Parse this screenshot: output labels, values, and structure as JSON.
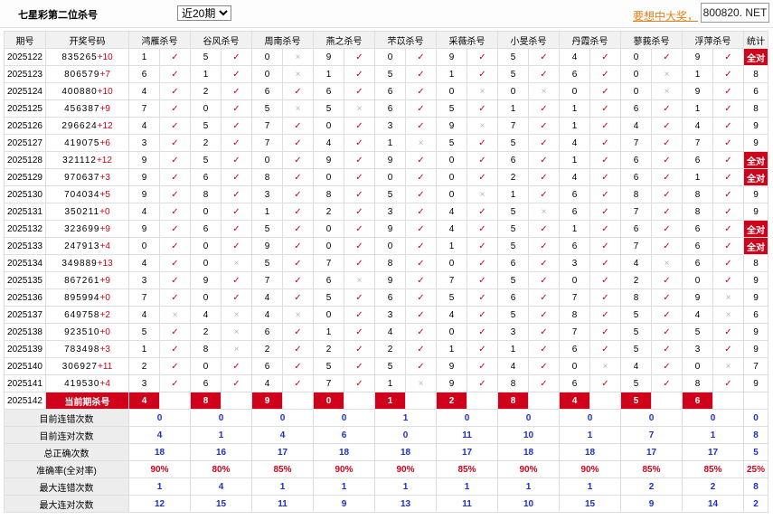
{
  "header": {
    "title": "七星彩第二位杀号",
    "select_value": "近20期",
    "select_options": [
      "近20期"
    ],
    "promo_text": "要想中大奖，",
    "site_badge": "800820. NET"
  },
  "columns": {
    "issue": "期号",
    "draw": "开奖号码",
    "experts": [
      "鸿雁杀号",
      "谷风杀号",
      "周南杀号",
      "燕之杀号",
      "芣苡杀号",
      "采薇杀号",
      "小旻杀号",
      "丹霞杀号",
      "蓼莪杀号",
      "浮萍杀号"
    ],
    "stat": "统计"
  },
  "marks": {
    "correct": "✓",
    "wrong": "×"
  },
  "rows": [
    {
      "issue": "2025122",
      "digits": "835265",
      "sum": "+10",
      "kills": [
        "1",
        "5",
        "0",
        "9",
        "0",
        "9",
        "5",
        "4",
        "0",
        "9"
      ],
      "ok": [
        1,
        1,
        0,
        1,
        1,
        1,
        1,
        1,
        1,
        1
      ],
      "stat": "全对"
    },
    {
      "issue": "2025123",
      "digits": "806579",
      "sum": "+7",
      "kills": [
        "6",
        "1",
        "0",
        "1",
        "5",
        "1",
        "5",
        "6",
        "0",
        "1"
      ],
      "ok": [
        1,
        1,
        0,
        1,
        1,
        1,
        1,
        1,
        0,
        1
      ],
      "stat": "8"
    },
    {
      "issue": "2025124",
      "digits": "400880",
      "sum": "+10",
      "kills": [
        "4",
        "2",
        "6",
        "6",
        "6",
        "0",
        "0",
        "0",
        "0",
        "9"
      ],
      "ok": [
        1,
        1,
        1,
        1,
        1,
        0,
        0,
        1,
        0,
        1
      ],
      "stat": "6"
    },
    {
      "issue": "2025125",
      "digits": "456387",
      "sum": "+9",
      "kills": [
        "7",
        "0",
        "5",
        "5",
        "6",
        "5",
        "1",
        "1",
        "6",
        "1"
      ],
      "ok": [
        1,
        1,
        0,
        0,
        1,
        1,
        1,
        1,
        1,
        1
      ],
      "stat": "8"
    },
    {
      "issue": "2025126",
      "digits": "296624",
      "sum": "+12",
      "kills": [
        "4",
        "5",
        "7",
        "0",
        "3",
        "9",
        "7",
        "1",
        "4",
        "4"
      ],
      "ok": [
        1,
        1,
        1,
        1,
        1,
        0,
        1,
        1,
        1,
        1
      ],
      "stat": "9"
    },
    {
      "issue": "2025127",
      "digits": "419075",
      "sum": "+6",
      "kills": [
        "3",
        "2",
        "7",
        "4",
        "1",
        "5",
        "5",
        "4",
        "7",
        "7"
      ],
      "ok": [
        1,
        1,
        1,
        1,
        0,
        1,
        1,
        1,
        1,
        1
      ],
      "stat": "9"
    },
    {
      "issue": "2025128",
      "digits": "321112",
      "sum": "+12",
      "kills": [
        "9",
        "5",
        "0",
        "9",
        "9",
        "0",
        "6",
        "1",
        "6",
        "6"
      ],
      "ok": [
        1,
        1,
        1,
        1,
        1,
        1,
        1,
        1,
        1,
        1
      ],
      "stat": "全对"
    },
    {
      "issue": "2025129",
      "digits": "970637",
      "sum": "+3",
      "kills": [
        "9",
        "6",
        "8",
        "0",
        "0",
        "0",
        "2",
        "4",
        "6",
        "1"
      ],
      "ok": [
        1,
        1,
        1,
        1,
        1,
        1,
        1,
        1,
        1,
        1
      ],
      "stat": "全对"
    },
    {
      "issue": "2025130",
      "digits": "704034",
      "sum": "+5",
      "kills": [
        "9",
        "8",
        "3",
        "8",
        "5",
        "0",
        "1",
        "6",
        "8",
        "8"
      ],
      "ok": [
        1,
        1,
        1,
        1,
        1,
        0,
        1,
        1,
        1,
        1
      ],
      "stat": "9"
    },
    {
      "issue": "2025131",
      "digits": "350211",
      "sum": "+0",
      "kills": [
        "4",
        "0",
        "1",
        "2",
        "3",
        "4",
        "5",
        "6",
        "7",
        "8"
      ],
      "ok": [
        1,
        1,
        1,
        1,
        1,
        1,
        0,
        1,
        1,
        1
      ],
      "stat": "9"
    },
    {
      "issue": "2025132",
      "digits": "323699",
      "sum": "+9",
      "kills": [
        "9",
        "6",
        "5",
        "0",
        "9",
        "4",
        "5",
        "1",
        "6",
        "6"
      ],
      "ok": [
        1,
        1,
        1,
        1,
        1,
        1,
        1,
        1,
        1,
        1
      ],
      "stat": "全对"
    },
    {
      "issue": "2025133",
      "digits": "247913",
      "sum": "+4",
      "kills": [
        "0",
        "0",
        "9",
        "0",
        "0",
        "1",
        "5",
        "6",
        "7",
        "6"
      ],
      "ok": [
        1,
        1,
        1,
        1,
        1,
        1,
        1,
        1,
        1,
        1
      ],
      "stat": "全对"
    },
    {
      "issue": "2025134",
      "digits": "349889",
      "sum": "+13",
      "kills": [
        "4",
        "0",
        "5",
        "7",
        "8",
        "0",
        "6",
        "3",
        "4",
        "6"
      ],
      "ok": [
        1,
        0,
        1,
        1,
        1,
        1,
        1,
        1,
        0,
        1
      ],
      "stat": "8"
    },
    {
      "issue": "2025135",
      "digits": "867261",
      "sum": "+9",
      "kills": [
        "3",
        "9",
        "7",
        "6",
        "9",
        "7",
        "5",
        "0",
        "2",
        "0"
      ],
      "ok": [
        1,
        1,
        1,
        0,
        1,
        1,
        1,
        1,
        1,
        1
      ],
      "stat": "9"
    },
    {
      "issue": "2025136",
      "digits": "895994",
      "sum": "+0",
      "kills": [
        "7",
        "0",
        "4",
        "5",
        "6",
        "5",
        "6",
        "7",
        "8",
        "9"
      ],
      "ok": [
        1,
        1,
        1,
        1,
        1,
        1,
        1,
        1,
        1,
        0
      ],
      "stat": "9"
    },
    {
      "issue": "2025137",
      "digits": "649758",
      "sum": "+2",
      "kills": [
        "4",
        "4",
        "4",
        "0",
        "3",
        "4",
        "5",
        "8",
        "5",
        "4"
      ],
      "ok": [
        0,
        0,
        0,
        1,
        1,
        1,
        1,
        1,
        1,
        0
      ],
      "stat": "6"
    },
    {
      "issue": "2025138",
      "digits": "923510",
      "sum": "+0",
      "kills": [
        "5",
        "2",
        "6",
        "1",
        "4",
        "0",
        "3",
        "7",
        "5",
        "5"
      ],
      "ok": [
        1,
        0,
        1,
        1,
        1,
        1,
        1,
        1,
        1,
        1
      ],
      "stat": "9"
    },
    {
      "issue": "2025139",
      "digits": "783498",
      "sum": "+3",
      "kills": [
        "1",
        "8",
        "2",
        "2",
        "2",
        "1",
        "1",
        "6",
        "5",
        "3"
      ],
      "ok": [
        1,
        0,
        1,
        1,
        1,
        1,
        1,
        1,
        1,
        1
      ],
      "stat": "9"
    },
    {
      "issue": "2025140",
      "digits": "306927",
      "sum": "+11",
      "kills": [
        "2",
        "0",
        "6",
        "5",
        "5",
        "9",
        "4",
        "0",
        "4",
        "0"
      ],
      "ok": [
        1,
        1,
        1,
        1,
        1,
        1,
        1,
        0,
        1,
        0
      ],
      "stat": "7"
    },
    {
      "issue": "2025141",
      "digits": "419530",
      "sum": "+4",
      "kills": [
        "3",
        "6",
        "4",
        "7",
        "1",
        "9",
        "8",
        "6",
        "5",
        "8"
      ],
      "ok": [
        1,
        1,
        1,
        1,
        0,
        1,
        1,
        1,
        1,
        1
      ],
      "stat": "9"
    }
  ],
  "current": {
    "issue": "2025142",
    "label": "当前期杀号",
    "kills": [
      "4",
      "8",
      "9",
      "0",
      "1",
      "2",
      "8",
      "4",
      "5",
      "6"
    ]
  },
  "summary": [
    {
      "label": "目前连错次数",
      "values": [
        "0",
        "0",
        "0",
        "0",
        "1",
        "0",
        "0",
        "0",
        "0",
        "0",
        "0"
      ],
      "color": "blue"
    },
    {
      "label": "目前连对次数",
      "values": [
        "4",
        "1",
        "4",
        "6",
        "0",
        "11",
        "10",
        "1",
        "7",
        "1",
        "8"
      ],
      "color": "blue"
    },
    {
      "label": "总正确次数",
      "values": [
        "18",
        "16",
        "17",
        "18",
        "18",
        "17",
        "18",
        "18",
        "17",
        "17",
        "5"
      ],
      "color": "blue"
    },
    {
      "label": "准确率(全对率)",
      "values": [
        "90%",
        "80%",
        "85%",
        "90%",
        "90%",
        "85%",
        "90%",
        "90%",
        "85%",
        "85%",
        "25%"
      ],
      "color": "red"
    },
    {
      "label": "最大连错次数",
      "values": [
        "1",
        "4",
        "1",
        "1",
        "1",
        "1",
        "1",
        "1",
        "2",
        "2",
        "8"
      ],
      "color": "blue"
    },
    {
      "label": "最大连对次数",
      "values": [
        "12",
        "15",
        "11",
        "9",
        "13",
        "11",
        "10",
        "15",
        "9",
        "14",
        "2"
      ],
      "color": "blue"
    }
  ]
}
